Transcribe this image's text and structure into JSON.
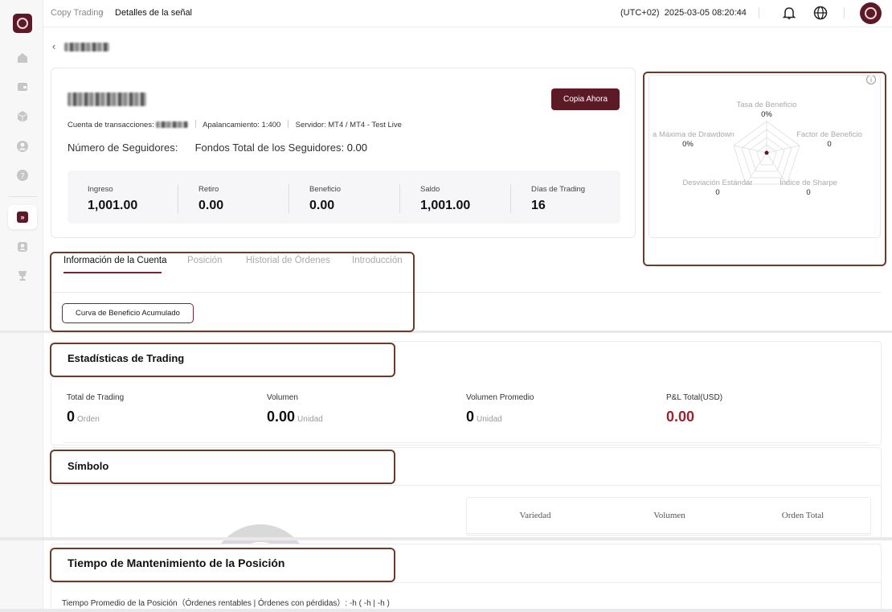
{
  "sidebar": {
    "items": [
      {
        "icon": "home-icon"
      },
      {
        "icon": "wallet-icon"
      },
      {
        "icon": "cube-icon"
      },
      {
        "icon": "user-icon"
      },
      {
        "icon": "help-icon"
      },
      {
        "icon": "copy-trading-icon",
        "active": true,
        "glyph": "»"
      },
      {
        "icon": "account-icon"
      },
      {
        "icon": "trophy-icon"
      }
    ]
  },
  "topbar": {
    "breadcrumb_root": "Copy Trading",
    "breadcrumb_current": "Detalles de la señal",
    "timezone": "(UTC+02)",
    "datetime": "2025-03-05 08:20:44"
  },
  "signal": {
    "copy_button": "Copia Ahora",
    "account_label": "Cuenta de transacciones:",
    "leverage": "Apalancamiento: 1:400",
    "server": "Servidor: MT4 / MT4 - Test Live",
    "followers_label": "Número de Seguidores:",
    "funds_label": "Fondos Total de los Seguidores:",
    "funds_value": "0.00"
  },
  "stats": [
    {
      "label": "Ingreso",
      "value": "1,001.00"
    },
    {
      "label": "Retiro",
      "value": "0.00"
    },
    {
      "label": "Beneficio",
      "value": "0.00"
    },
    {
      "label": "Saldo",
      "value": "1,001.00"
    },
    {
      "label": "Días de Trading",
      "value": "16"
    }
  ],
  "radar": {
    "axes": [
      {
        "label": "Tasa de Beneficio",
        "value": "0%"
      },
      {
        "label": "Factor de Beneficio",
        "value": "0"
      },
      {
        "label": "Índice de Sharpe",
        "value": "0"
      },
      {
        "label": "Desviación Estándar",
        "value": "0"
      },
      {
        "label": "a Máxima de Drawdown",
        "value": "0%"
      }
    ]
  },
  "tabs": [
    {
      "label": "Información de la Cuenta",
      "active": true
    },
    {
      "label": "Posición",
      "active": false
    },
    {
      "label": "Historial de Órdenes",
      "active": false
    },
    {
      "label": "Introducción",
      "active": false
    }
  ],
  "curve_button": "Curva de Beneficio Acumulado",
  "trading_stats": {
    "title": "Estadísticas de Trading",
    "items": [
      {
        "label": "Total de Trading",
        "value": "0",
        "unit": "Orden"
      },
      {
        "label": "Volumen",
        "value": "0.00",
        "unit": "Unidad"
      },
      {
        "label": "Volumen Promedio",
        "value": "0",
        "unit": "Unidad"
      },
      {
        "label": "P&L Total(USD)",
        "value": "0.00",
        "unit": ""
      }
    ]
  },
  "symbol": {
    "title": "Símbolo",
    "columns": [
      "Variedad",
      "Volumen",
      "Orden Total"
    ]
  },
  "holding": {
    "title": "Tiempo de Mantenimiento de la Posición",
    "text": "Tiempo Promedio de la Posición（Órdenes rentables | Órdenes con pérdidas）: -h ( -h | -h )"
  },
  "colors": {
    "brand": "#5c1a26",
    "accent": "#7a2430",
    "negative": "#9b2330"
  }
}
